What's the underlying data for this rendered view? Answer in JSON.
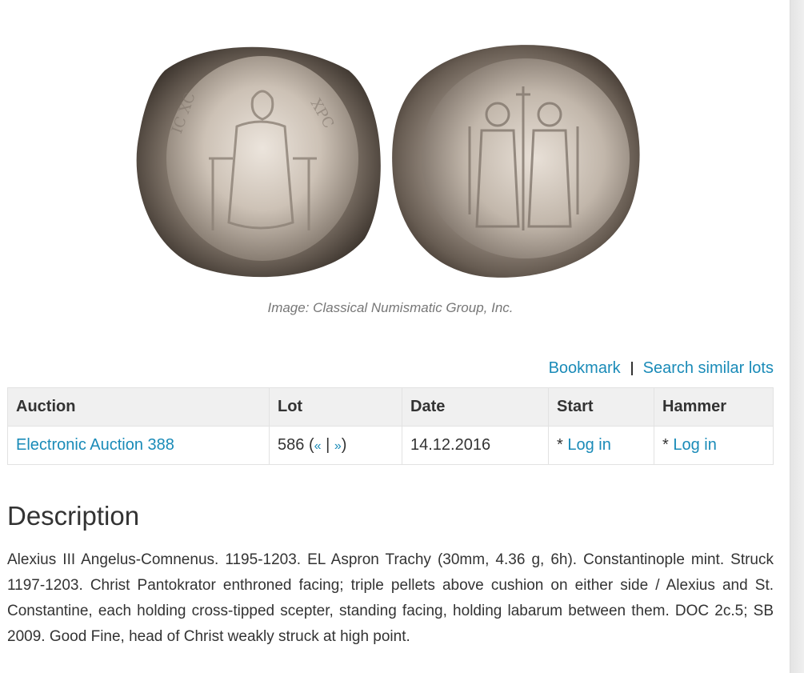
{
  "image": {
    "credit": "Image: Classical Numismatic Group, Inc."
  },
  "actions": {
    "bookmark": "Bookmark",
    "search_similar": "Search similar lots"
  },
  "table": {
    "headers": [
      "Auction",
      "Lot",
      "Date",
      "Start",
      "Hammer"
    ],
    "row": {
      "auction": "Electronic Auction 388",
      "lot_number": "586",
      "lot_prev": "«",
      "lot_divider": "|",
      "lot_next": "»",
      "date": "14.12.2016",
      "start_prefix": "* ",
      "start_link": "Log in",
      "hammer_prefix": "* ",
      "hammer_link": "Log in"
    }
  },
  "description": {
    "heading": "Description",
    "text": "Alexius III Angelus-Comnenus. 1195-1203. EL Aspron Trachy (30mm, 4.36 g, 6h). Constantinople mint. Struck 1197-1203. Christ Pantokrator enthroned facing; triple pellets above cushion on either side / Alexius and St. Constantine, each holding cross-tipped scepter, standing facing, holding labarum between them. DOC 2c.5; SB 2009. Good Fine, head of Christ weakly struck at high point."
  },
  "colors": {
    "link": "#1a8bb8",
    "text": "#333333",
    "header_bg": "#f0f0f0",
    "credit": "#777777"
  }
}
